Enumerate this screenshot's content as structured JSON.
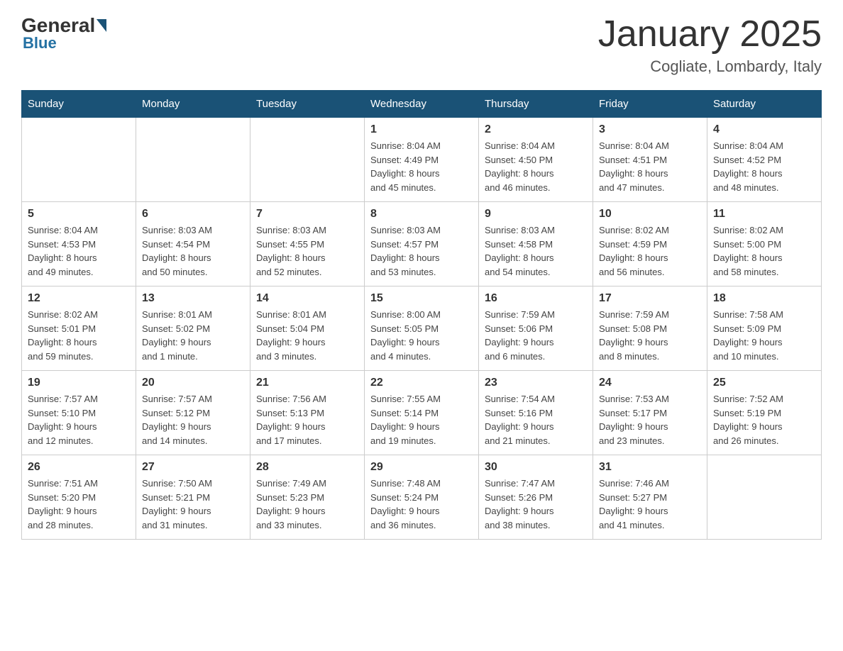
{
  "header": {
    "logo": {
      "general": "General",
      "blue": "Blue"
    },
    "title": "January 2025",
    "subtitle": "Cogliate, Lombardy, Italy"
  },
  "weekdays": [
    "Sunday",
    "Monday",
    "Tuesday",
    "Wednesday",
    "Thursday",
    "Friday",
    "Saturday"
  ],
  "weeks": [
    [
      {
        "day": "",
        "info": ""
      },
      {
        "day": "",
        "info": ""
      },
      {
        "day": "",
        "info": ""
      },
      {
        "day": "1",
        "info": "Sunrise: 8:04 AM\nSunset: 4:49 PM\nDaylight: 8 hours\nand 45 minutes."
      },
      {
        "day": "2",
        "info": "Sunrise: 8:04 AM\nSunset: 4:50 PM\nDaylight: 8 hours\nand 46 minutes."
      },
      {
        "day": "3",
        "info": "Sunrise: 8:04 AM\nSunset: 4:51 PM\nDaylight: 8 hours\nand 47 minutes."
      },
      {
        "day": "4",
        "info": "Sunrise: 8:04 AM\nSunset: 4:52 PM\nDaylight: 8 hours\nand 48 minutes."
      }
    ],
    [
      {
        "day": "5",
        "info": "Sunrise: 8:04 AM\nSunset: 4:53 PM\nDaylight: 8 hours\nand 49 minutes."
      },
      {
        "day": "6",
        "info": "Sunrise: 8:03 AM\nSunset: 4:54 PM\nDaylight: 8 hours\nand 50 minutes."
      },
      {
        "day": "7",
        "info": "Sunrise: 8:03 AM\nSunset: 4:55 PM\nDaylight: 8 hours\nand 52 minutes."
      },
      {
        "day": "8",
        "info": "Sunrise: 8:03 AM\nSunset: 4:57 PM\nDaylight: 8 hours\nand 53 minutes."
      },
      {
        "day": "9",
        "info": "Sunrise: 8:03 AM\nSunset: 4:58 PM\nDaylight: 8 hours\nand 54 minutes."
      },
      {
        "day": "10",
        "info": "Sunrise: 8:02 AM\nSunset: 4:59 PM\nDaylight: 8 hours\nand 56 minutes."
      },
      {
        "day": "11",
        "info": "Sunrise: 8:02 AM\nSunset: 5:00 PM\nDaylight: 8 hours\nand 58 minutes."
      }
    ],
    [
      {
        "day": "12",
        "info": "Sunrise: 8:02 AM\nSunset: 5:01 PM\nDaylight: 8 hours\nand 59 minutes."
      },
      {
        "day": "13",
        "info": "Sunrise: 8:01 AM\nSunset: 5:02 PM\nDaylight: 9 hours\nand 1 minute."
      },
      {
        "day": "14",
        "info": "Sunrise: 8:01 AM\nSunset: 5:04 PM\nDaylight: 9 hours\nand 3 minutes."
      },
      {
        "day": "15",
        "info": "Sunrise: 8:00 AM\nSunset: 5:05 PM\nDaylight: 9 hours\nand 4 minutes."
      },
      {
        "day": "16",
        "info": "Sunrise: 7:59 AM\nSunset: 5:06 PM\nDaylight: 9 hours\nand 6 minutes."
      },
      {
        "day": "17",
        "info": "Sunrise: 7:59 AM\nSunset: 5:08 PM\nDaylight: 9 hours\nand 8 minutes."
      },
      {
        "day": "18",
        "info": "Sunrise: 7:58 AM\nSunset: 5:09 PM\nDaylight: 9 hours\nand 10 minutes."
      }
    ],
    [
      {
        "day": "19",
        "info": "Sunrise: 7:57 AM\nSunset: 5:10 PM\nDaylight: 9 hours\nand 12 minutes."
      },
      {
        "day": "20",
        "info": "Sunrise: 7:57 AM\nSunset: 5:12 PM\nDaylight: 9 hours\nand 14 minutes."
      },
      {
        "day": "21",
        "info": "Sunrise: 7:56 AM\nSunset: 5:13 PM\nDaylight: 9 hours\nand 17 minutes."
      },
      {
        "day": "22",
        "info": "Sunrise: 7:55 AM\nSunset: 5:14 PM\nDaylight: 9 hours\nand 19 minutes."
      },
      {
        "day": "23",
        "info": "Sunrise: 7:54 AM\nSunset: 5:16 PM\nDaylight: 9 hours\nand 21 minutes."
      },
      {
        "day": "24",
        "info": "Sunrise: 7:53 AM\nSunset: 5:17 PM\nDaylight: 9 hours\nand 23 minutes."
      },
      {
        "day": "25",
        "info": "Sunrise: 7:52 AM\nSunset: 5:19 PM\nDaylight: 9 hours\nand 26 minutes."
      }
    ],
    [
      {
        "day": "26",
        "info": "Sunrise: 7:51 AM\nSunset: 5:20 PM\nDaylight: 9 hours\nand 28 minutes."
      },
      {
        "day": "27",
        "info": "Sunrise: 7:50 AM\nSunset: 5:21 PM\nDaylight: 9 hours\nand 31 minutes."
      },
      {
        "day": "28",
        "info": "Sunrise: 7:49 AM\nSunset: 5:23 PM\nDaylight: 9 hours\nand 33 minutes."
      },
      {
        "day": "29",
        "info": "Sunrise: 7:48 AM\nSunset: 5:24 PM\nDaylight: 9 hours\nand 36 minutes."
      },
      {
        "day": "30",
        "info": "Sunrise: 7:47 AM\nSunset: 5:26 PM\nDaylight: 9 hours\nand 38 minutes."
      },
      {
        "day": "31",
        "info": "Sunrise: 7:46 AM\nSunset: 5:27 PM\nDaylight: 9 hours\nand 41 minutes."
      },
      {
        "day": "",
        "info": ""
      }
    ]
  ]
}
